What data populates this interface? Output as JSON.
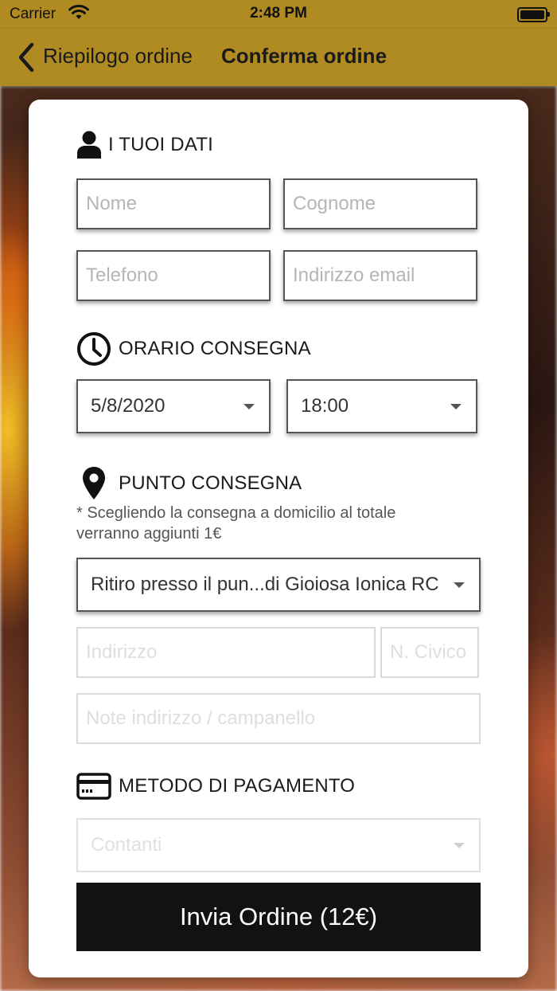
{
  "status_bar": {
    "carrier": "Carrier",
    "time": "2:48 PM"
  },
  "nav": {
    "back_label": "Riepilogo ordine",
    "title": "Conferma ordine"
  },
  "colors": {
    "accent": "#b08b22",
    "button": "#121212"
  },
  "sections": {
    "personal": {
      "title": "I TUOI DATI",
      "icon": "user-icon",
      "first_name_placeholder": "Nome",
      "last_name_placeholder": "Cognome",
      "phone_placeholder": "Telefono",
      "email_placeholder": "Indirizzo email"
    },
    "delivery_time": {
      "title": "ORARIO CONSEGNA",
      "icon": "clock-icon",
      "date_value": "5/8/2020",
      "time_value": "18:00"
    },
    "delivery_point": {
      "title": "PUNTO CONSEGNA",
      "icon": "map-pin-icon",
      "note": "* Scegliendo la consegna a domicilio al totale verranno aggiunti 1€",
      "selected_option": "Ritiro presso il pun...di Gioiosa Ionica RC",
      "address_placeholder": "Indirizzo",
      "civic_placeholder": "N. Civico",
      "notes_placeholder": "Note indirizzo / campanello"
    },
    "payment": {
      "title": "METODO DI PAGAMENTO",
      "icon": "credit-card-icon",
      "selected_method": "Contanti"
    }
  },
  "submit_label": "Invia Ordine (12€)"
}
